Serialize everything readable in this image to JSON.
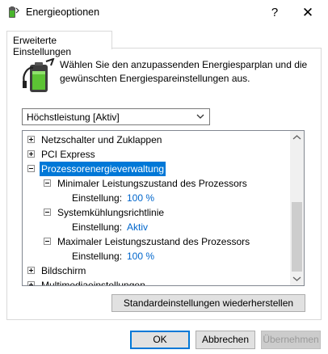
{
  "window": {
    "title": "Energieoptionen",
    "help_glyph": "?",
    "close_glyph": "✕"
  },
  "tab": {
    "label": "Erweiterte Einstellungen"
  },
  "intro": {
    "line1": "Wählen Sie den anzupassenden Energiesparplan und die",
    "line2": "gewünschten Energiespareinstellungen aus."
  },
  "plan_select": {
    "value": "Höchstleistung [Aktiv]"
  },
  "tree": {
    "items": [
      {
        "label": "Netzschalter und Zuklappen",
        "expander": "+"
      },
      {
        "label": "PCI Express",
        "expander": "+"
      },
      {
        "label": "Prozessorenergieverwaltung",
        "expander": "-",
        "selected": true
      },
      {
        "label": "Minimaler Leistungszustand des Prozessors",
        "expander": "-"
      },
      {
        "setting_label": "Einstellung:",
        "value": "100 %"
      },
      {
        "label": "Systemkühlungsrichtlinie",
        "expander": "-"
      },
      {
        "setting_label": "Einstellung:",
        "value": "Aktiv"
      },
      {
        "label": "Maximaler Leistungszustand des Prozessors",
        "expander": "-"
      },
      {
        "setting_label": "Einstellung:",
        "value": "100 %"
      },
      {
        "label": "Bildschirm",
        "expander": "+"
      },
      {
        "label": "Multimediaeinstellungen",
        "expander": "+"
      }
    ]
  },
  "buttons": {
    "restore": "Standardeinstellungen wiederherstellen",
    "ok": "OK",
    "cancel": "Abbrechen",
    "apply": "Übernehmen"
  },
  "colors": {
    "selection": "#0078d7",
    "setting_value": "#0066cc"
  }
}
